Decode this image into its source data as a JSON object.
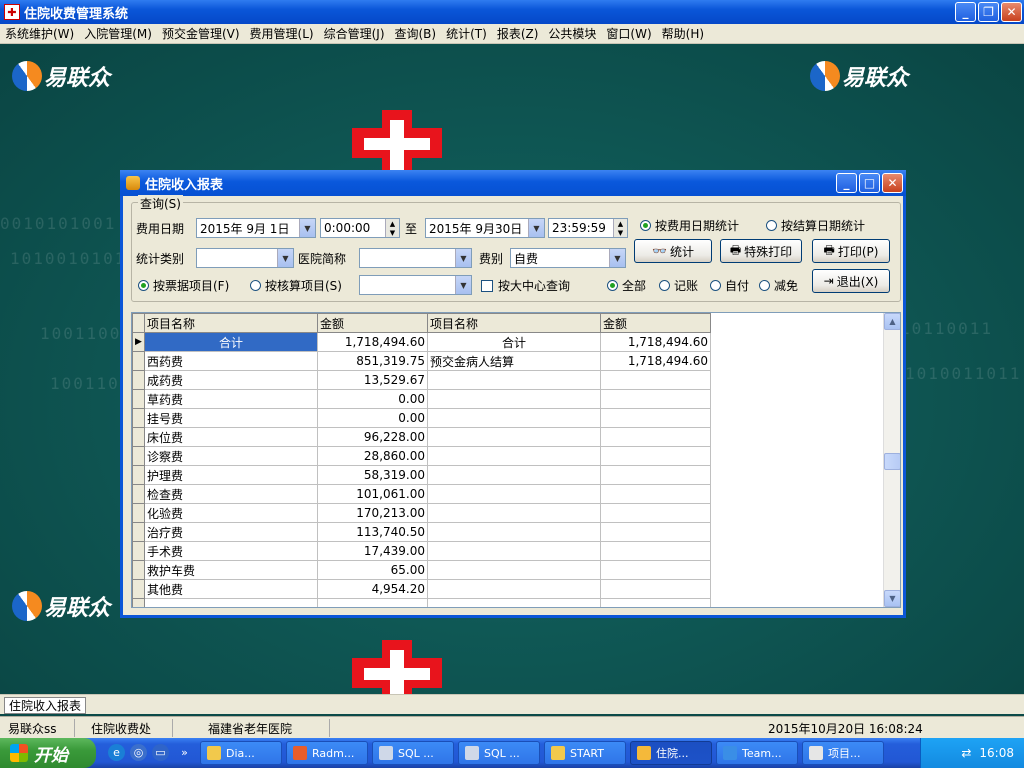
{
  "window": {
    "title": "住院收费管理系统"
  },
  "menu": [
    "系统维护(W)",
    "入院管理(M)",
    "预交金管理(V)",
    "费用管理(L)",
    "综合管理(J)",
    "查询(B)",
    "统计(T)",
    "报表(Z)",
    "公共模块",
    "窗口(W)",
    "帮助(H)"
  ],
  "brand": {
    "logo_text": "易联众"
  },
  "dialog": {
    "title": "住院收入报表",
    "group_label": "查询(S)",
    "fee_date_label": "费用日期",
    "start_date": "2015年 9月 1日",
    "start_time": "0:00:00",
    "to_label": "至",
    "end_date": "2015年 9月30日",
    "end_time": "23:59:59",
    "radio_fee_date": "按费用日期统计",
    "radio_settle_date": "按结算日期统计",
    "category_label": "统计类别",
    "hospital_label": "医院简称",
    "fee_type_label": "费别",
    "fee_type_value": "自费",
    "btn_stat": "统计",
    "btn_special_print": "特殊打印",
    "btn_print": "打印(P)",
    "btn_exit": "退出(X)",
    "radio_ticket_item": "按票据项目(F)",
    "radio_check_item": "按核算项目(S)",
    "check_center": "按大中心查询",
    "radio_all": "全部",
    "radio_account": "记账",
    "radio_self": "自付",
    "radio_reduce": "减免"
  },
  "table": {
    "headers": [
      "项目名称",
      "金额",
      "项目名称",
      "金额"
    ],
    "rows": [
      [
        "合计",
        "1,718,494.60",
        "合计",
        "1,718,494.60"
      ],
      [
        "西药费",
        "851,319.75",
        "预交金病人结算",
        "1,718,494.60"
      ],
      [
        "成药费",
        "13,529.67",
        "",
        ""
      ],
      [
        "草药费",
        "0.00",
        "",
        ""
      ],
      [
        "挂号费",
        "0.00",
        "",
        ""
      ],
      [
        "床位费",
        "96,228.00",
        "",
        ""
      ],
      [
        "诊察费",
        "28,860.00",
        "",
        ""
      ],
      [
        "护理费",
        "58,319.00",
        "",
        ""
      ],
      [
        "检查费",
        "101,061.00",
        "",
        ""
      ],
      [
        "化验费",
        "170,213.00",
        "",
        ""
      ],
      [
        "治疗费",
        "113,740.50",
        "",
        ""
      ],
      [
        "手术费",
        "17,439.00",
        "",
        ""
      ],
      [
        "救护车费",
        "65.00",
        "",
        ""
      ],
      [
        "其他费",
        "4,954.20",
        "",
        ""
      ]
    ]
  },
  "mdi": {
    "tab": "住院收入报表"
  },
  "status": {
    "user": "易联众ss",
    "dept": "住院收费处",
    "hospital": "福建省老年医院",
    "datetime": "2015年10月20日 16:08:24"
  },
  "taskbar": {
    "start": "开始",
    "items": [
      "Dia...",
      "Radm...",
      "SQL ...",
      "SQL ...",
      "START",
      "住院...",
      "Team...",
      "项目..."
    ],
    "clock": "16:08"
  }
}
